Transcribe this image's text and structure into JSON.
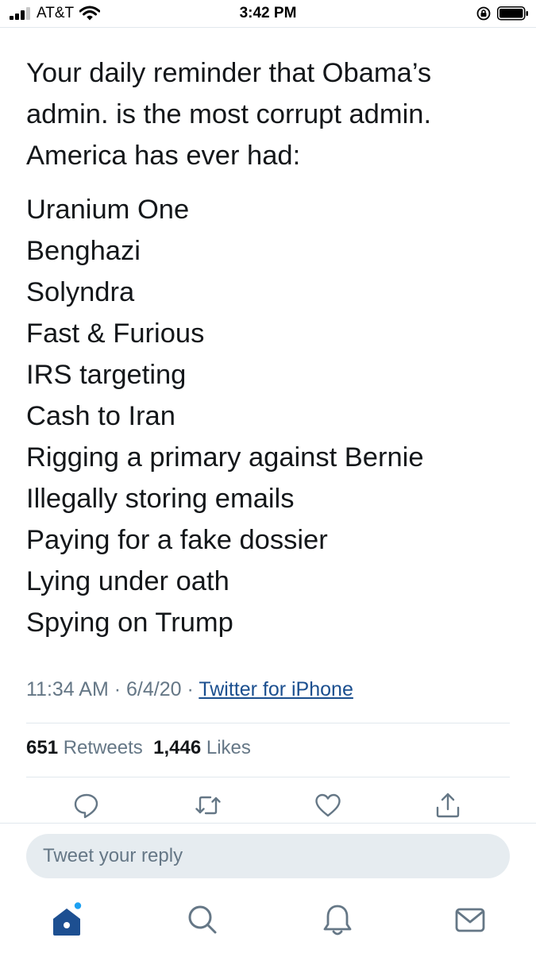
{
  "status_bar": {
    "carrier": "AT&T",
    "time": "3:42 PM"
  },
  "tweet": {
    "intro": "Your daily reminder that Obama’s admin. is the most corrupt admin. America has ever had:",
    "items": [
      "Uranium One",
      "Benghazi",
      "Solyndra",
      "Fast & Furious",
      "IRS targeting",
      "Cash to Iran",
      "Rigging a primary against Bernie",
      "Illegally storing emails",
      "Paying for a fake dossier",
      "Lying under oath",
      "Spying on Trump"
    ],
    "time": "11:34 AM",
    "date": "6/4/20",
    "separator": "·",
    "source": "Twitter for iPhone"
  },
  "stats": {
    "retweets_count": "651",
    "retweets_label": "Retweets",
    "likes_count": "1,446",
    "likes_label": "Likes"
  },
  "reply": {
    "placeholder": "Tweet your reply"
  },
  "icons": {
    "actions": [
      "reply-icon",
      "retweet-icon",
      "like-icon",
      "share-icon"
    ],
    "tabs": [
      "home-icon",
      "search-icon",
      "notifications-icon",
      "messages-icon"
    ]
  },
  "colors": {
    "accent": "#1da1f2",
    "home_tab": "#1d4f91",
    "link": "#1b4f8f",
    "secondary_text": "#657786",
    "reply_bg": "#e6ecf0"
  }
}
